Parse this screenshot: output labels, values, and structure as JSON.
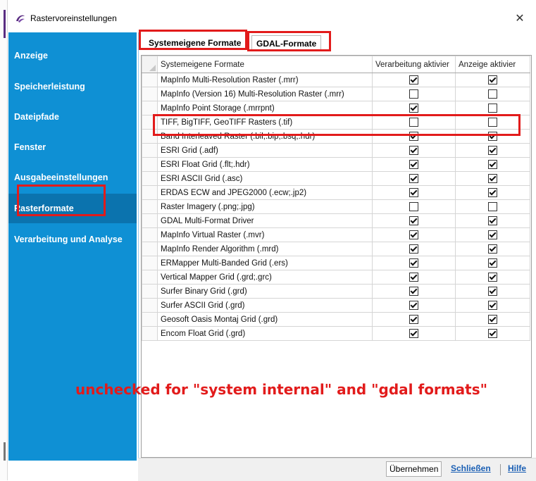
{
  "window": {
    "title": "Rastervoreinstellungen",
    "close_glyph": "✕"
  },
  "sidebar": {
    "items": [
      {
        "label": "Anzeige",
        "active": false
      },
      {
        "label": "Speicherleistung",
        "active": false
      },
      {
        "label": "Dateipfade",
        "active": false
      },
      {
        "label": "Fenster",
        "active": false
      },
      {
        "label": "Ausgabeeinstellungen",
        "active": false
      },
      {
        "label": "Rasterformate",
        "active": true
      },
      {
        "label": "Verarbeitung und Analyse",
        "active": false
      }
    ]
  },
  "tabs": [
    {
      "label": "Systemeigene Formate",
      "selected": false
    },
    {
      "label": "GDAL-Formate",
      "selected": true
    }
  ],
  "table": {
    "columns": [
      "Systemeigene Formate",
      "Verarbeitung aktivier",
      "Anzeige aktivier"
    ],
    "rows": [
      {
        "name": "MapInfo Multi-Resolution Raster (.mrr)",
        "processing": true,
        "display": true
      },
      {
        "name": "MapInfo (Version 16) Multi-Resolution Raster (.mrr)",
        "processing": false,
        "display": false
      },
      {
        "name": "MapInfo Point Storage (.mrrpnt)",
        "processing": true,
        "display": false
      },
      {
        "name": "TIFF, BigTIFF, GeoTIFF Rasters (.tif)",
        "processing": false,
        "display": false
      },
      {
        "name": "Band Interleaved Raster (.bil;.bip;.bsq;.hdr)",
        "processing": true,
        "display": true
      },
      {
        "name": "ESRI Grid (.adf)",
        "processing": true,
        "display": true
      },
      {
        "name": "ESRI Float Grid (.flt;.hdr)",
        "processing": true,
        "display": true
      },
      {
        "name": "ESRI ASCII Grid (.asc)",
        "processing": true,
        "display": true
      },
      {
        "name": "ERDAS ECW and JPEG2000 (.ecw;.jp2)",
        "processing": true,
        "display": true
      },
      {
        "name": "Raster Imagery (.png;.jpg)",
        "processing": false,
        "display": false
      },
      {
        "name": "GDAL Multi-Format Driver",
        "processing": true,
        "display": true
      },
      {
        "name": "MapInfo Virtual Raster (.mvr)",
        "processing": true,
        "display": true
      },
      {
        "name": "MapInfo Render Algorithm (.mrd)",
        "processing": true,
        "display": true
      },
      {
        "name": "ERMapper Multi-Banded Grid (.ers)",
        "processing": true,
        "display": true
      },
      {
        "name": "Vertical Mapper Grid (.grd;.grc)",
        "processing": true,
        "display": true
      },
      {
        "name": "Surfer Binary Grid (.grd)",
        "processing": true,
        "display": true
      },
      {
        "name": "Surfer ASCII Grid (.grd)",
        "processing": true,
        "display": true
      },
      {
        "name": "Geosoft Oasis Montaj Grid (.grd)",
        "processing": true,
        "display": true
      },
      {
        "name": "Encom Float Grid (.grd)",
        "processing": true,
        "display": true
      }
    ]
  },
  "annotation": {
    "text": "unchecked for \"system internal\" and \"gdal formats\"",
    "color": "#e21b1b"
  },
  "footer": {
    "apply": "Übernehmen",
    "close": "Schließen",
    "help": "Hilfe"
  },
  "colors": {
    "sidebar_bg": "#0f90d4",
    "sidebar_active": "#0b73ae",
    "highlight_red": "#e21b1b",
    "link": "#1a5fb4"
  }
}
